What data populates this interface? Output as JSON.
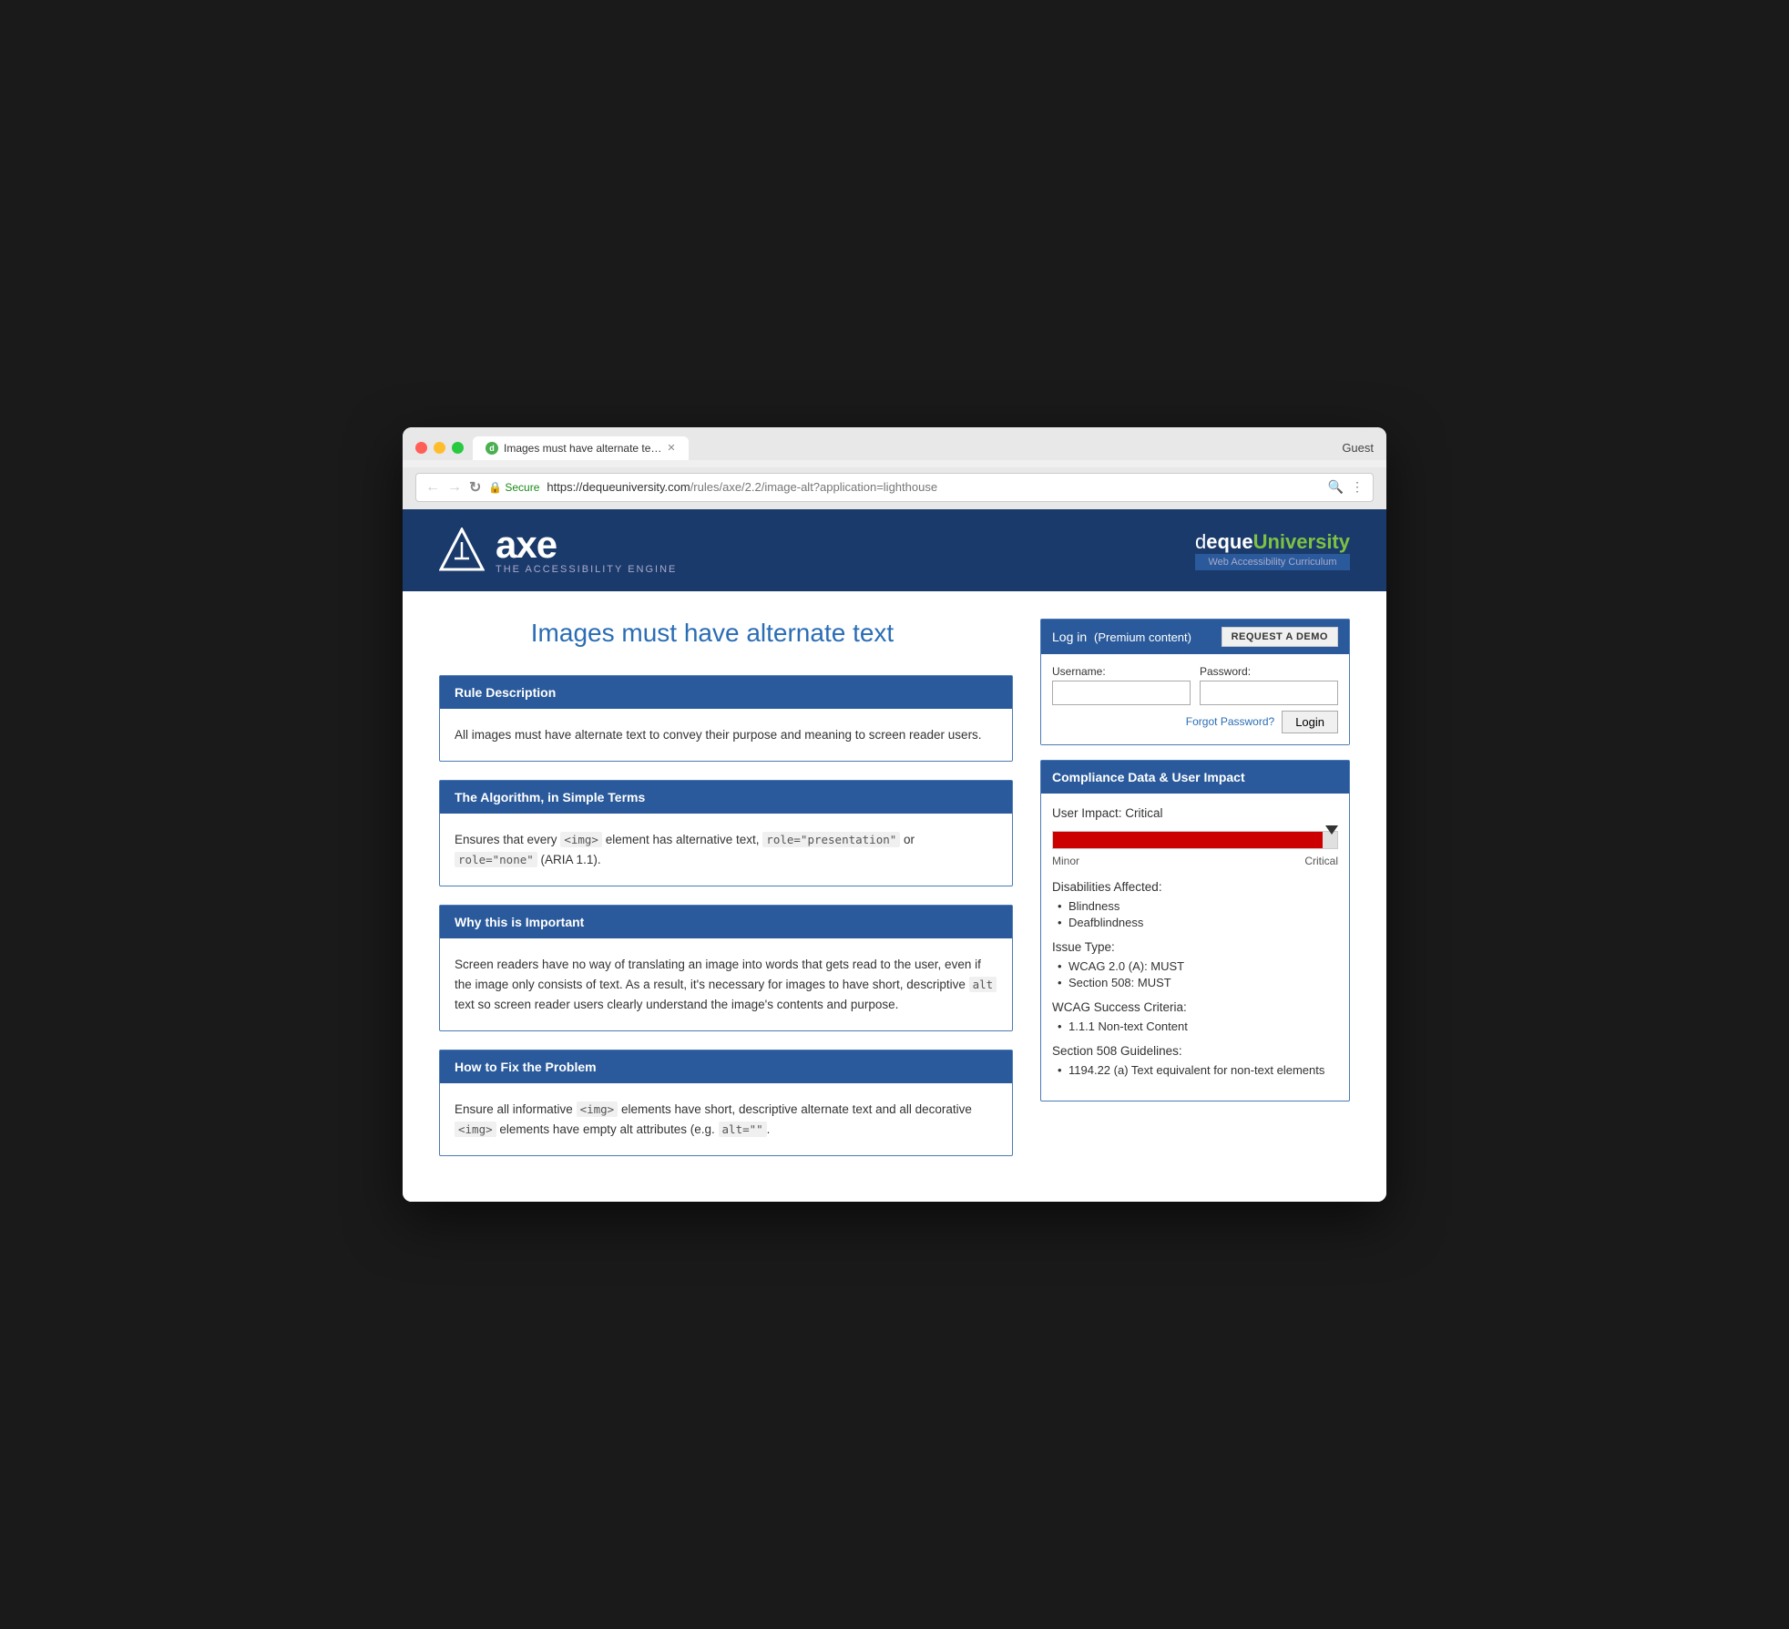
{
  "browser": {
    "tab_title": "Images must have alternate te…",
    "guest_label": "Guest",
    "url_secure": "Secure",
    "url_full": "https://dequeuniversity.com/rules/axe/2.2/image-alt?application=lighthouse",
    "url_base": "https://dequeuniversity.com",
    "url_path": "/rules/axe/2.2/image-alt?application=lighthouse"
  },
  "header": {
    "axe_name": "axe",
    "axe_subtitle": "THE ACCESSIBILITY ENGINE",
    "deque_logo": "dequeUniversity",
    "deque_tagline": "Web Accessibility Curriculum"
  },
  "page": {
    "title": "Images must have alternate text"
  },
  "sections": {
    "rule_description": {
      "header": "Rule Description",
      "body": "All images must have alternate text to convey their purpose and meaning to screen reader users."
    },
    "algorithm": {
      "header": "The Algorithm, in Simple Terms",
      "body_prefix": "Ensures that every ",
      "code1": "<img>",
      "body_middle": " element has alternative text, ",
      "code2": "role=\"presentation\"",
      "body_middle2": " or ",
      "code3": "role=\"none\"",
      "body_suffix": " (ARIA 1.1)."
    },
    "why_important": {
      "header": "Why this is Important",
      "body_prefix": "Screen readers have no way of translating an image into words that gets read to the user, even if the image only consists of text. As a result, it's necessary for images to have short, descriptive ",
      "code1": "alt",
      "body_suffix": " text so screen reader users clearly understand the image's contents and purpose."
    },
    "how_to_fix": {
      "header": "How to Fix the Problem",
      "body_prefix": "Ensure all informative ",
      "code1": "<img>",
      "body_middle": " elements have short, descriptive alternate text and all decorative ",
      "code2": "<img>",
      "body_suffix": " elements have empty alt attributes (e.g. ",
      "code3": "alt=\"\"",
      "body_end": "."
    }
  },
  "login": {
    "header_text": "Log in",
    "header_sub": "(Premium content)",
    "request_demo_label": "REQUEST A DEMO",
    "username_label": "Username:",
    "password_label": "Password:",
    "login_btn": "Login",
    "forgot_label": "Forgot Password?"
  },
  "compliance": {
    "header": "Compliance Data & User Impact",
    "user_impact_label": "User Impact: Critical",
    "bar_min_label": "Minor",
    "bar_max_label": "Critical",
    "disabilities_title": "Disabilities Affected:",
    "disabilities": [
      "Blindness",
      "Deafblindness"
    ],
    "issue_type_title": "Issue Type:",
    "issue_types": [
      "WCAG 2.0 (A): MUST",
      "Section 508: MUST"
    ],
    "wcag_title": "WCAG Success Criteria:",
    "wcag_items": [
      "1.1.1 Non-text Content"
    ],
    "section508_title": "Section 508 Guidelines:",
    "section508_items": [
      "1194.22 (a) Text equivalent for non-text elements"
    ]
  }
}
